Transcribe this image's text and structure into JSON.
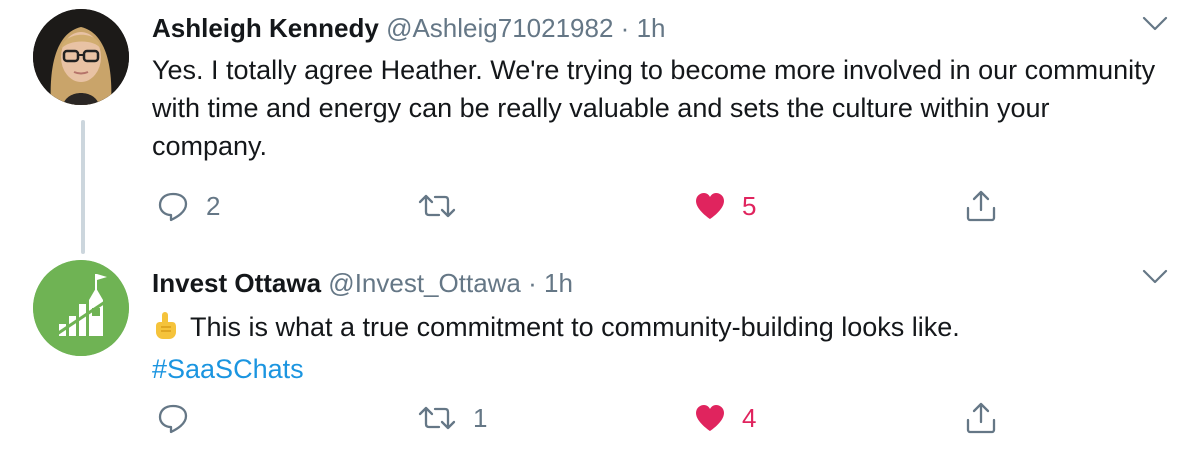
{
  "tweets": [
    {
      "name": "Ashleigh Kennedy",
      "handle": "@Ashleig71021982",
      "separator": "·",
      "time": "1h",
      "text": "Yes. I totally agree Heather. We're trying to become more involved in our community with time and energy can be really valuable and sets the culture within your company.",
      "replies": "2",
      "retweets": "",
      "likes": "5"
    },
    {
      "name": "Invest Ottawa",
      "handle": "@Invest_Ottawa",
      "separator": "·",
      "time": "1h",
      "text": "This is what a true commitment to community-building looks like.",
      "hashtag": "#SaaSChats",
      "replies": "",
      "retweets": "1",
      "likes": "4"
    }
  ],
  "colors": {
    "like": "#e0245e",
    "link": "#1b95e0",
    "muted": "#657786",
    "thread_line": "#ccd6dd",
    "brand_green": "#6fb354"
  },
  "icons": [
    "reply-icon",
    "retweet-icon",
    "heart-icon",
    "share-icon",
    "caret-down-icon",
    "pointing-up-emoji"
  ]
}
